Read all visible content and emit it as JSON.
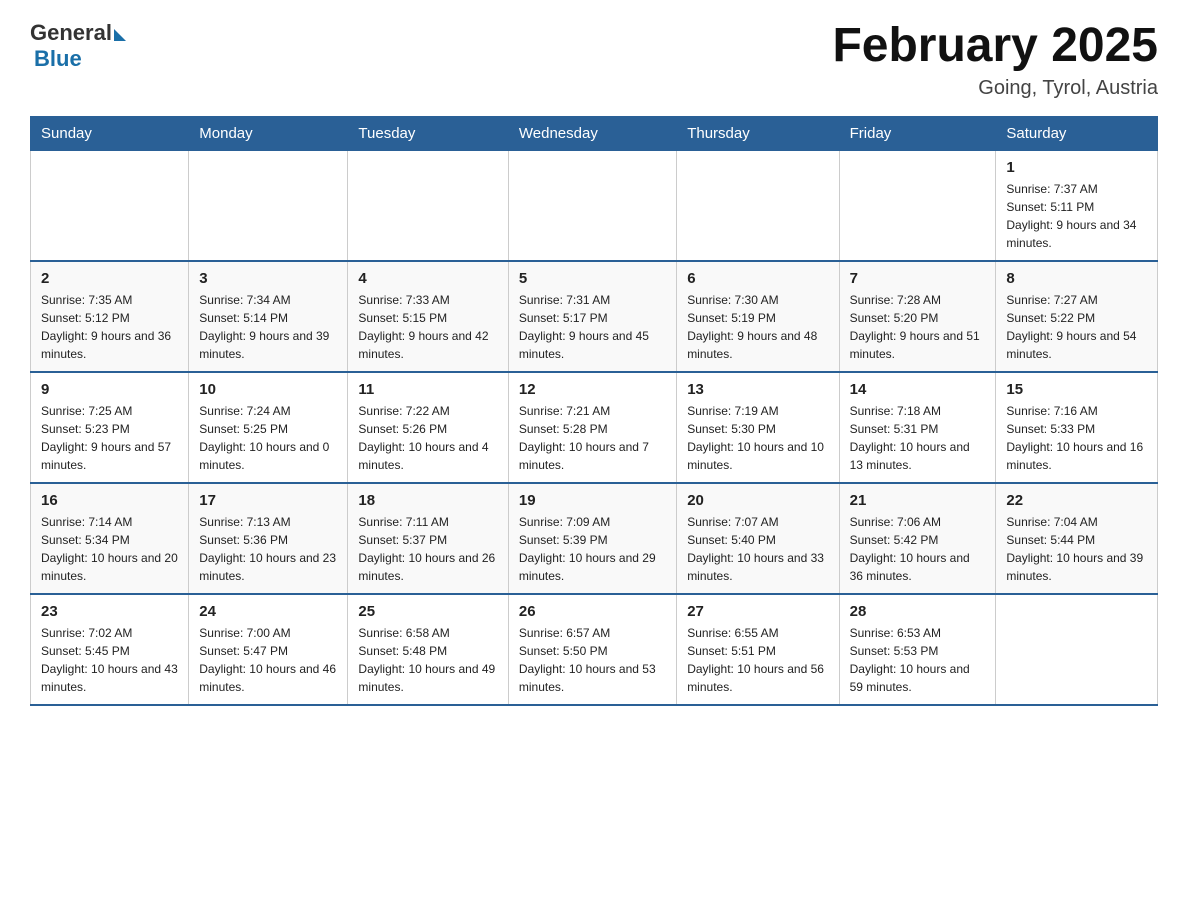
{
  "logo": {
    "general": "General",
    "blue": "Blue"
  },
  "title": {
    "month_year": "February 2025",
    "location": "Going, Tyrol, Austria"
  },
  "weekdays": [
    "Sunday",
    "Monday",
    "Tuesday",
    "Wednesday",
    "Thursday",
    "Friday",
    "Saturday"
  ],
  "weeks": [
    [
      {
        "day": "",
        "info": ""
      },
      {
        "day": "",
        "info": ""
      },
      {
        "day": "",
        "info": ""
      },
      {
        "day": "",
        "info": ""
      },
      {
        "day": "",
        "info": ""
      },
      {
        "day": "",
        "info": ""
      },
      {
        "day": "1",
        "info": "Sunrise: 7:37 AM\nSunset: 5:11 PM\nDaylight: 9 hours and 34 minutes."
      }
    ],
    [
      {
        "day": "2",
        "info": "Sunrise: 7:35 AM\nSunset: 5:12 PM\nDaylight: 9 hours and 36 minutes."
      },
      {
        "day": "3",
        "info": "Sunrise: 7:34 AM\nSunset: 5:14 PM\nDaylight: 9 hours and 39 minutes."
      },
      {
        "day": "4",
        "info": "Sunrise: 7:33 AM\nSunset: 5:15 PM\nDaylight: 9 hours and 42 minutes."
      },
      {
        "day": "5",
        "info": "Sunrise: 7:31 AM\nSunset: 5:17 PM\nDaylight: 9 hours and 45 minutes."
      },
      {
        "day": "6",
        "info": "Sunrise: 7:30 AM\nSunset: 5:19 PM\nDaylight: 9 hours and 48 minutes."
      },
      {
        "day": "7",
        "info": "Sunrise: 7:28 AM\nSunset: 5:20 PM\nDaylight: 9 hours and 51 minutes."
      },
      {
        "day": "8",
        "info": "Sunrise: 7:27 AM\nSunset: 5:22 PM\nDaylight: 9 hours and 54 minutes."
      }
    ],
    [
      {
        "day": "9",
        "info": "Sunrise: 7:25 AM\nSunset: 5:23 PM\nDaylight: 9 hours and 57 minutes."
      },
      {
        "day": "10",
        "info": "Sunrise: 7:24 AM\nSunset: 5:25 PM\nDaylight: 10 hours and 0 minutes."
      },
      {
        "day": "11",
        "info": "Sunrise: 7:22 AM\nSunset: 5:26 PM\nDaylight: 10 hours and 4 minutes."
      },
      {
        "day": "12",
        "info": "Sunrise: 7:21 AM\nSunset: 5:28 PM\nDaylight: 10 hours and 7 minutes."
      },
      {
        "day": "13",
        "info": "Sunrise: 7:19 AM\nSunset: 5:30 PM\nDaylight: 10 hours and 10 minutes."
      },
      {
        "day": "14",
        "info": "Sunrise: 7:18 AM\nSunset: 5:31 PM\nDaylight: 10 hours and 13 minutes."
      },
      {
        "day": "15",
        "info": "Sunrise: 7:16 AM\nSunset: 5:33 PM\nDaylight: 10 hours and 16 minutes."
      }
    ],
    [
      {
        "day": "16",
        "info": "Sunrise: 7:14 AM\nSunset: 5:34 PM\nDaylight: 10 hours and 20 minutes."
      },
      {
        "day": "17",
        "info": "Sunrise: 7:13 AM\nSunset: 5:36 PM\nDaylight: 10 hours and 23 minutes."
      },
      {
        "day": "18",
        "info": "Sunrise: 7:11 AM\nSunset: 5:37 PM\nDaylight: 10 hours and 26 minutes."
      },
      {
        "day": "19",
        "info": "Sunrise: 7:09 AM\nSunset: 5:39 PM\nDaylight: 10 hours and 29 minutes."
      },
      {
        "day": "20",
        "info": "Sunrise: 7:07 AM\nSunset: 5:40 PM\nDaylight: 10 hours and 33 minutes."
      },
      {
        "day": "21",
        "info": "Sunrise: 7:06 AM\nSunset: 5:42 PM\nDaylight: 10 hours and 36 minutes."
      },
      {
        "day": "22",
        "info": "Sunrise: 7:04 AM\nSunset: 5:44 PM\nDaylight: 10 hours and 39 minutes."
      }
    ],
    [
      {
        "day": "23",
        "info": "Sunrise: 7:02 AM\nSunset: 5:45 PM\nDaylight: 10 hours and 43 minutes."
      },
      {
        "day": "24",
        "info": "Sunrise: 7:00 AM\nSunset: 5:47 PM\nDaylight: 10 hours and 46 minutes."
      },
      {
        "day": "25",
        "info": "Sunrise: 6:58 AM\nSunset: 5:48 PM\nDaylight: 10 hours and 49 minutes."
      },
      {
        "day": "26",
        "info": "Sunrise: 6:57 AM\nSunset: 5:50 PM\nDaylight: 10 hours and 53 minutes."
      },
      {
        "day": "27",
        "info": "Sunrise: 6:55 AM\nSunset: 5:51 PM\nDaylight: 10 hours and 56 minutes."
      },
      {
        "day": "28",
        "info": "Sunrise: 6:53 AM\nSunset: 5:53 PM\nDaylight: 10 hours and 59 minutes."
      },
      {
        "day": "",
        "info": ""
      }
    ]
  ]
}
